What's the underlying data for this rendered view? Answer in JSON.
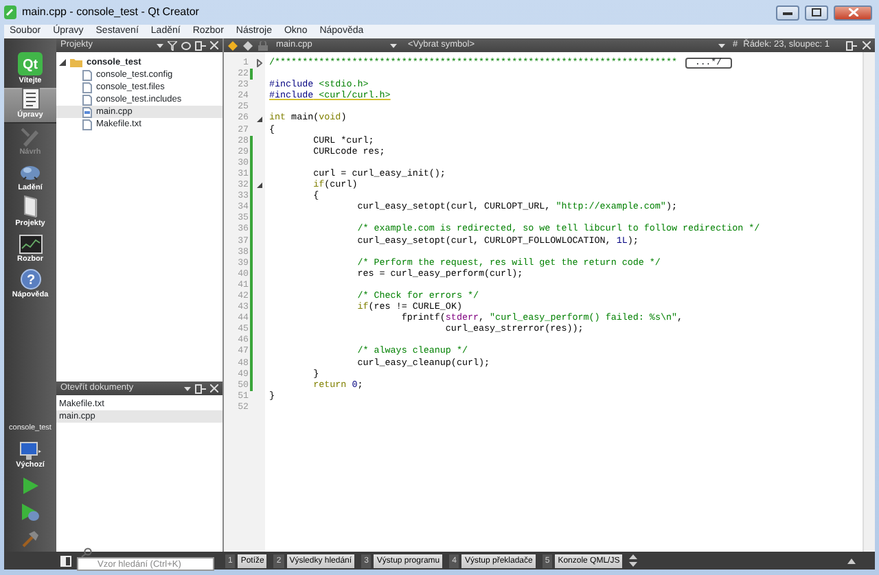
{
  "window": {
    "title": "main.cpp - console_test - Qt Creator"
  },
  "menu": [
    "Soubor",
    "Úpravy",
    "Sestavení",
    "Ladění",
    "Rozbor",
    "Nástroje",
    "Okno",
    "Nápověda"
  ],
  "modes": [
    {
      "kind": "welcome",
      "label": "Vítejte",
      "logo": "Qt",
      "selected": false,
      "disabled": false
    },
    {
      "kind": "edit",
      "label": "Úpravy",
      "selected": true,
      "disabled": false
    },
    {
      "kind": "design",
      "label": "Návrh",
      "selected": false,
      "disabled": true
    },
    {
      "kind": "debug",
      "label": "Ladění",
      "selected": false,
      "disabled": false
    },
    {
      "kind": "projects",
      "label": "Projekty",
      "selected": false,
      "disabled": false
    },
    {
      "kind": "analyze",
      "label": "Rozbor",
      "selected": false,
      "disabled": false
    },
    {
      "kind": "help",
      "label": "Nápověda",
      "glyph": "?",
      "selected": false,
      "disabled": false
    }
  ],
  "target": {
    "project": "console_test",
    "configuration": "Výchozí"
  },
  "run_buttons": [
    {
      "kind": "run"
    },
    {
      "kind": "debug-run"
    },
    {
      "kind": "build"
    }
  ],
  "projects_panel": {
    "title": "Projekty",
    "tree": [
      {
        "label": "console_test",
        "expanded": true,
        "children": [
          {
            "label": "console_test.config",
            "selected": false
          },
          {
            "label": "console_test.files",
            "selected": false
          },
          {
            "label": "console_test.includes",
            "selected": false
          },
          {
            "label": "main.cpp",
            "selected": true
          },
          {
            "label": "Makefile.txt",
            "selected": false
          }
        ]
      }
    ]
  },
  "open_documents": {
    "title": "Otevřít dokumenty",
    "items": [
      {
        "label": "Makefile.txt",
        "selected": false
      },
      {
        "label": "main.cpp",
        "selected": true
      }
    ]
  },
  "editor": {
    "file": "main.cpp",
    "symbol": "<Vybrat symbol>",
    "hash": "#",
    "position": "Řádek: 23, sloupec: 1",
    "lines": [
      {
        "number": "1",
        "foldable": true,
        "folded": true,
        "changed": false,
        "folded_text": "...*/",
        "segments": [
          {
            "kind": "comment",
            "text": "/*************************************************************************"
          }
        ]
      },
      {
        "number": "22",
        "changed": true
      },
      {
        "number": "23",
        "changed": false,
        "segments": [
          {
            "kind": "preproc",
            "text": "#include"
          },
          {
            "kind": "include",
            "text": " <stdio.h>"
          }
        ]
      },
      {
        "number": "24",
        "changed": false,
        "underlined": true,
        "segments": [
          {
            "kind": "preproc",
            "text": "#include"
          },
          {
            "kind": "include",
            "text": " <curl/curl.h>"
          }
        ]
      },
      {
        "number": "25",
        "changed": false
      },
      {
        "number": "26",
        "foldable": true,
        "folded": false,
        "changed": false,
        "segments": [
          {
            "kind": "keyword",
            "text": "int"
          },
          {
            "kind": "plain",
            "text": " main("
          },
          {
            "kind": "keyword",
            "text": "void"
          },
          {
            "kind": "plain",
            "text": ")"
          }
        ]
      },
      {
        "number": "27",
        "changed": false,
        "segments": [
          {
            "kind": "plain",
            "text": "{"
          }
        ]
      },
      {
        "number": "28",
        "changed": true,
        "segments": [
          {
            "kind": "plain",
            "text": "        CURL *curl;"
          }
        ]
      },
      {
        "number": "29",
        "changed": true,
        "segments": [
          {
            "kind": "plain",
            "text": "        CURLcode res;"
          }
        ]
      },
      {
        "number": "30",
        "changed": true
      },
      {
        "number": "31",
        "changed": true,
        "segments": [
          {
            "kind": "plain",
            "text": "        curl = curl_easy_init();"
          }
        ]
      },
      {
        "number": "32",
        "foldable": true,
        "folded": false,
        "changed": true,
        "segments": [
          {
            "kind": "keyword",
            "text": "        if"
          },
          {
            "kind": "plain",
            "text": "(curl)"
          }
        ]
      },
      {
        "number": "33",
        "changed": true,
        "segments": [
          {
            "kind": "plain",
            "text": "        {"
          }
        ]
      },
      {
        "number": "34",
        "changed": true,
        "segments": [
          {
            "kind": "plain",
            "text": "                curl_easy_setopt(curl, CURLOPT_URL, "
          },
          {
            "kind": "string",
            "text": "\"http://example.com\""
          },
          {
            "kind": "plain",
            "text": ");"
          }
        ]
      },
      {
        "number": "35",
        "changed": true
      },
      {
        "number": "36",
        "changed": true,
        "segments": [
          {
            "kind": "comment",
            "text": "                /* example.com is redirected, so we tell libcurl to follow redirection */"
          }
        ]
      },
      {
        "number": "37",
        "changed": true,
        "segments": [
          {
            "kind": "plain",
            "text": "                curl_easy_setopt(curl, CURLOPT_FOLLOWLOCATION, "
          },
          {
            "kind": "number",
            "text": "1L"
          },
          {
            "kind": "plain",
            "text": ");"
          }
        ]
      },
      {
        "number": "38",
        "changed": true
      },
      {
        "number": "39",
        "changed": true,
        "segments": [
          {
            "kind": "comment",
            "text": "                /* Perform the request, res will get the return code */"
          }
        ]
      },
      {
        "number": "40",
        "changed": true,
        "segments": [
          {
            "kind": "plain",
            "text": "                res = curl_easy_perform(curl);"
          }
        ]
      },
      {
        "number": "41",
        "changed": true
      },
      {
        "number": "42",
        "changed": true,
        "segments": [
          {
            "kind": "comment",
            "text": "                /* Check for errors */"
          }
        ]
      },
      {
        "number": "43",
        "changed": true,
        "segments": [
          {
            "kind": "keyword",
            "text": "                if"
          },
          {
            "kind": "plain",
            "text": "(res != CURLE_OK)"
          }
        ]
      },
      {
        "number": "44",
        "changed": true,
        "segments": [
          {
            "kind": "plain",
            "text": "                        fprintf("
          },
          {
            "kind": "global",
            "text": "stderr"
          },
          {
            "kind": "plain",
            "text": ", "
          },
          {
            "kind": "string",
            "text": "\"curl_easy_perform() failed: %s\\n\""
          },
          {
            "kind": "plain",
            "text": ","
          }
        ]
      },
      {
        "number": "45",
        "changed": true,
        "segments": [
          {
            "kind": "plain",
            "text": "                                curl_easy_strerror(res));"
          }
        ]
      },
      {
        "number": "46",
        "changed": true
      },
      {
        "number": "47",
        "changed": true,
        "segments": [
          {
            "kind": "comment",
            "text": "                /* always cleanup */"
          }
        ]
      },
      {
        "number": "48",
        "changed": true,
        "segments": [
          {
            "kind": "plain",
            "text": "                curl_easy_cleanup(curl);"
          }
        ]
      },
      {
        "number": "49",
        "changed": true,
        "segments": [
          {
            "kind": "plain",
            "text": "        }"
          }
        ]
      },
      {
        "number": "50",
        "changed": true,
        "segments": [
          {
            "kind": "keyword",
            "text": "        return"
          },
          {
            "kind": "number",
            "text": " 0"
          },
          {
            "kind": "plain",
            "text": ";"
          }
        ]
      },
      {
        "number": "51",
        "changed": false,
        "segments": [
          {
            "kind": "plain",
            "text": "}"
          }
        ]
      },
      {
        "number": "52",
        "changed": false
      }
    ]
  },
  "search": {
    "placeholder": "Vzor hledání (Ctrl+K)"
  },
  "output_tabs": [
    {
      "number": "1",
      "label": "Potíže"
    },
    {
      "number": "2",
      "label": "Výsledky hledání"
    },
    {
      "number": "3",
      "label": "Výstup programu"
    },
    {
      "number": "4",
      "label": "Výstup překladače"
    },
    {
      "number": "5",
      "label": "Konzole QML/JS"
    }
  ]
}
